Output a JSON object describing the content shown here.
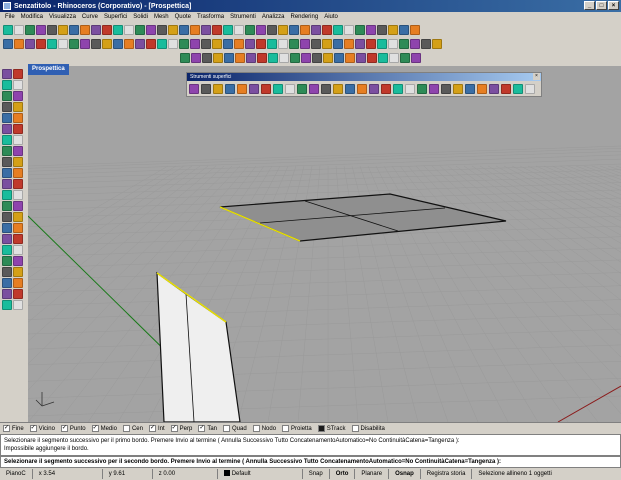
{
  "window": {
    "title": "Senzatitolo - Rhinoceros (Corporativo) - [Prospettica]",
    "controls": [
      "_",
      "□",
      "×"
    ]
  },
  "menu": [
    "File",
    "Modifica",
    "Visualizza",
    "Curve",
    "Superfici",
    "Solidi",
    "Mesh",
    "Quote",
    "Trasforma",
    "Strumenti",
    "Analizza",
    "Rendering",
    "Aiuto"
  ],
  "viewport": {
    "label": "Prospettica"
  },
  "floating_panel": {
    "title": "Strumenti superfici",
    "close": "×"
  },
  "osnaps": [
    {
      "label": "Fine",
      "checked": true
    },
    {
      "label": "Vicino",
      "checked": true
    },
    {
      "label": "Punto",
      "checked": true
    },
    {
      "label": "Medio",
      "checked": true
    },
    {
      "label": "Cen",
      "checked": false
    },
    {
      "label": "Int",
      "checked": true
    },
    {
      "label": "Perp",
      "checked": true
    },
    {
      "label": "Tan",
      "checked": true
    },
    {
      "label": "Quad",
      "checked": false
    },
    {
      "label": "Nodo",
      "checked": false
    },
    {
      "label": "Proietta",
      "checked": false
    },
    {
      "label": "STrack",
      "checked": false
    },
    {
      "label": "Disabilita",
      "checked": false
    }
  ],
  "command_history": [
    "Selezionare il segmento successivo per il primo bordo. Premere Invio al termine ( Annulla  Successivo  Tutto  ConcatenamentoAutomatico=No  ContinuitàCatena=Tangenza ):",
    "Impossibile aggiungere il bordo."
  ],
  "command_prompt": "Selezionare il segmento successivo per il secondo bordo. Premere Invio al termine ( Annulla  Successivo  Tutto  ConcatenamentoAutomatico=No  ContinuitàCatena=Tangenza ):",
  "status": {
    "plane": "PianoC",
    "x": "x 3.54",
    "y": "y 9.61",
    "z": "z 0.00",
    "layer": "Default",
    "snap": "Snap",
    "orto": "Orto",
    "planare": "Planare",
    "osnap": "Osnap",
    "history": "Registra storia",
    "selection": "Selezione allineno 1 oggetti"
  },
  "colors": {
    "viewport_bg": "#a3a3a3",
    "grid": "#9a9a9a",
    "selected_edge": "#e8e000",
    "x_axis": "#8b1a1a",
    "y_axis": "#1a7a1a"
  }
}
